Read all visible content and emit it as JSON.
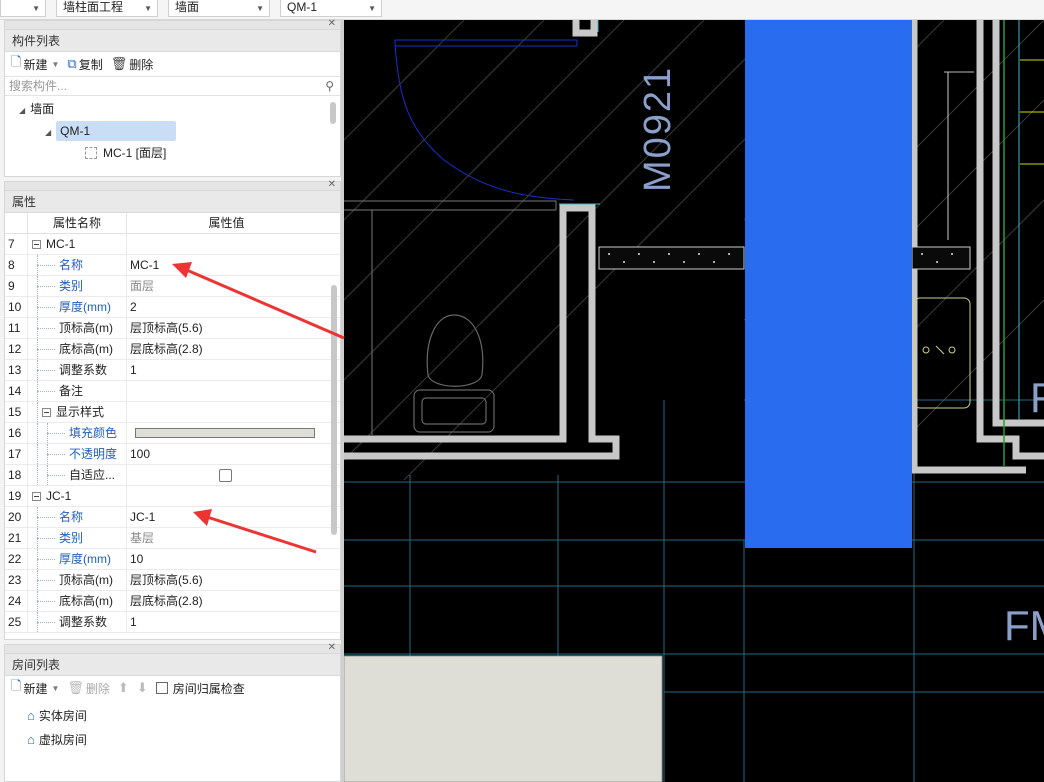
{
  "toolbar": {
    "combo1": "",
    "combo2": "墙柱面工程",
    "combo3": "墙面",
    "combo4": "QM-1"
  },
  "component_panel": {
    "title": "构件列表",
    "new_label": "新建",
    "copy_label": "复制",
    "delete_label": "删除",
    "search_placeholder": "搜索构件...",
    "tree": {
      "root": "墙面",
      "child": "QM-1",
      "leaf": "MC-1 [面层]"
    }
  },
  "property_panel": {
    "title": "属性",
    "col_name": "属性名称",
    "col_value": "属性值",
    "rows": [
      {
        "num": "7",
        "name": "MC-1",
        "value": ""
      },
      {
        "num": "8",
        "name": "名称",
        "value": "MC-1"
      },
      {
        "num": "9",
        "name": "类别",
        "value": "面层"
      },
      {
        "num": "10",
        "name": "厚度(mm)",
        "value": "2"
      },
      {
        "num": "11",
        "name": "顶标高(m)",
        "value": "层顶标高(5.6)"
      },
      {
        "num": "12",
        "name": "底标高(m)",
        "value": "层底标高(2.8)"
      },
      {
        "num": "13",
        "name": "调整系数",
        "value": "1"
      },
      {
        "num": "14",
        "name": "备注",
        "value": ""
      },
      {
        "num": "15",
        "name": "显示样式",
        "value": ""
      },
      {
        "num": "16",
        "name": "填充颜色",
        "value": ""
      },
      {
        "num": "17",
        "name": "不透明度",
        "value": "100"
      },
      {
        "num": "18",
        "name": "自适应...",
        "value": ""
      },
      {
        "num": "19",
        "name": "JC-1",
        "value": ""
      },
      {
        "num": "20",
        "name": "名称",
        "value": "JC-1"
      },
      {
        "num": "21",
        "name": "类别",
        "value": "基层"
      },
      {
        "num": "22",
        "name": "厚度(mm)",
        "value": "10"
      },
      {
        "num": "23",
        "name": "顶标高(m)",
        "value": "层顶标高(5.6)"
      },
      {
        "num": "24",
        "name": "底标高(m)",
        "value": "层底标高(2.8)"
      },
      {
        "num": "25",
        "name": "调整系数",
        "value": "1"
      }
    ],
    "fill_color": "#deded6"
  },
  "room_panel": {
    "title": "房间列表",
    "new_label": "新建",
    "delete_label": "删除",
    "check_label": "房间归属检查",
    "items": [
      "实体房间",
      "虚拟房间"
    ]
  },
  "canvas": {
    "door_label": "M0921",
    "fm_label": "FM",
    "blue_column_color": "#2a6cf0"
  }
}
